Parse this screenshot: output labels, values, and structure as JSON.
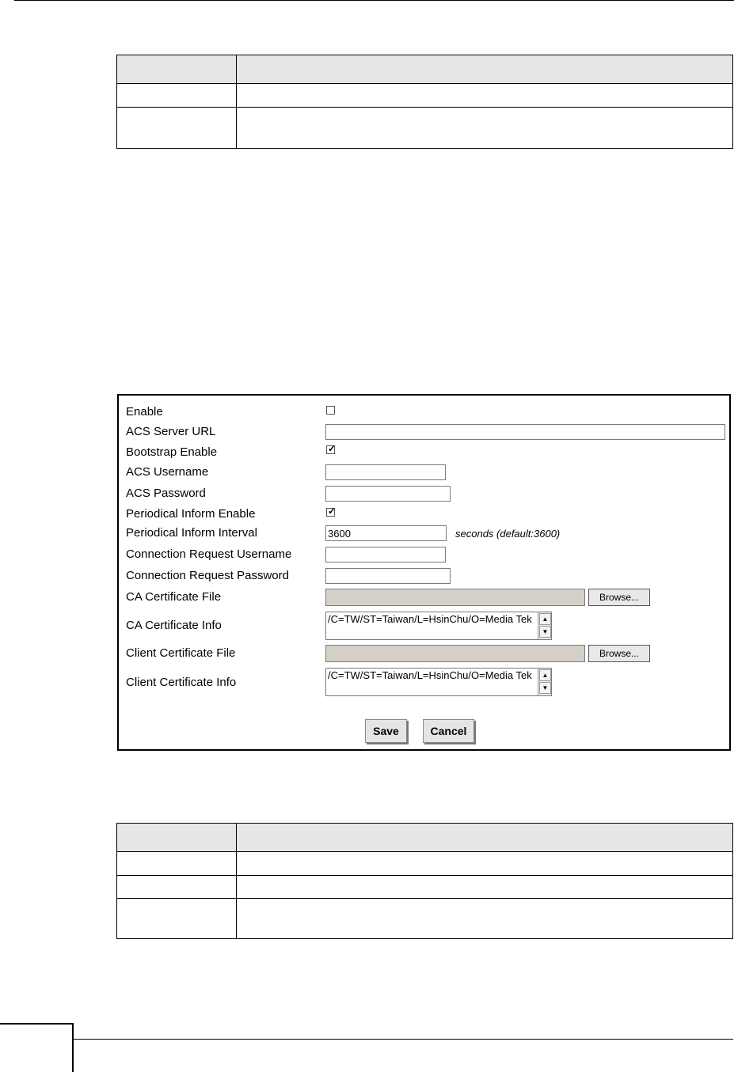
{
  "form": {
    "fields": [
      {
        "label": "Enable",
        "type": "checkbox",
        "checked": false
      },
      {
        "label": "ACS Server URL",
        "type": "text",
        "value": ""
      },
      {
        "label": "Bootstrap Enable",
        "type": "checkbox",
        "checked": true
      },
      {
        "label": "ACS Username",
        "type": "text",
        "value": ""
      },
      {
        "label": "ACS Password",
        "type": "text",
        "value": ""
      },
      {
        "label": "Periodical Inform Enable",
        "type": "checkbox",
        "checked": true
      },
      {
        "label": "Periodical Inform Interval",
        "type": "text",
        "value": "3600",
        "hint": "seconds (default:3600)"
      },
      {
        "label": "Connection Request Username",
        "type": "text",
        "value": ""
      },
      {
        "label": "Connection Request Password",
        "type": "text",
        "value": ""
      },
      {
        "label": "CA Certificate File",
        "type": "file",
        "button": "Browse..."
      },
      {
        "label": "CA Certificate Info",
        "type": "textarea",
        "value": "/C=TW/ST=Taiwan/L=HsinChu/O=Media Tek"
      },
      {
        "label": "Client Certificate File",
        "type": "file",
        "button": "Browse..."
      },
      {
        "label": "Client Certificate Info",
        "type": "textarea",
        "value": "/C=TW/ST=Taiwan/L=HsinChu/O=Media Tek"
      }
    ],
    "save_label": "Save",
    "cancel_label": "Cancel"
  },
  "colors": {
    "table_header_bg": "#e6e6e6",
    "file_field_bg": "#d4d0c8"
  }
}
